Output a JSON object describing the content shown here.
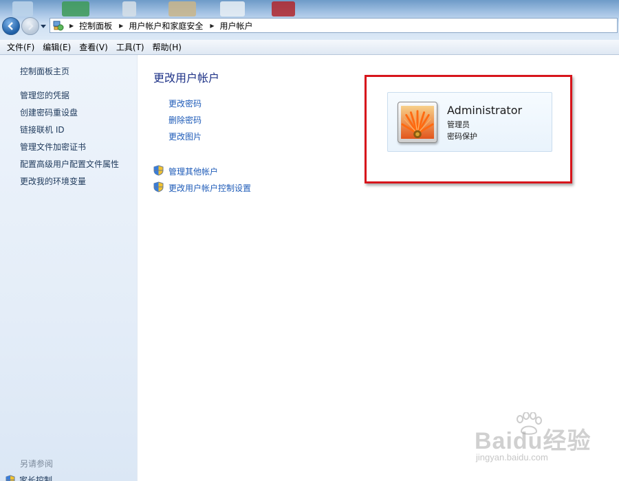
{
  "address": {
    "crumbs": [
      "控制面板",
      "用户帐户和家庭安全",
      "用户帐户"
    ]
  },
  "menu": [
    "文件(F)",
    "编辑(E)",
    "查看(V)",
    "工具(T)",
    "帮助(H)"
  ],
  "left_pane": {
    "home": "控制面板主页",
    "links": [
      "管理您的凭据",
      "创建密码重设盘",
      "链接联机 ID",
      "管理文件加密证书",
      "配置高级用户配置文件属性",
      "更改我的环境变量"
    ],
    "see_also": "另请参阅",
    "parental": "家长控制"
  },
  "main": {
    "title": "更改用户帐户",
    "tasks": [
      "更改密码",
      "删除密码",
      "更改图片"
    ],
    "admin_tasks": [
      "管理其他帐户",
      "更改用户帐户控制设置"
    ]
  },
  "user": {
    "name": "Administrator",
    "role": "管理员",
    "status": "密码保护"
  },
  "watermark": {
    "main": "Baidu经验",
    "sub": "jingyan.baidu.com"
  },
  "colors": {
    "highlight": "#d7141b",
    "link": "#1e5bb8",
    "title": "#1e3287"
  }
}
